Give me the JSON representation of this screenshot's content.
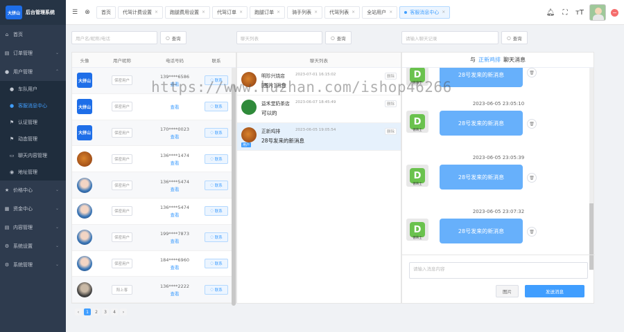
{
  "brand": {
    "logo": "大拼山",
    "name": "后台管理系统"
  },
  "sidebar": {
    "items": [
      {
        "label": "首页",
        "icon": "home-icon"
      },
      {
        "label": "订单管理",
        "icon": "order-icon"
      },
      {
        "label": "用户管理",
        "icon": "user-icon",
        "children": [
          {
            "label": "车队用户",
            "icon": "person-icon"
          },
          {
            "label": "客服消息中心",
            "icon": "person-icon",
            "active": true
          },
          {
            "label": "认证管理",
            "icon": "flag-icon"
          },
          {
            "label": "动态管理",
            "icon": "flag-icon"
          },
          {
            "label": "聊天内容管理",
            "icon": "chat-icon"
          },
          {
            "label": "地址管理",
            "icon": "location-icon"
          }
        ]
      },
      {
        "label": "价格中心",
        "icon": "star-icon"
      },
      {
        "label": "资金中心",
        "icon": "wallet-icon"
      },
      {
        "label": "内容管理",
        "icon": "doc-icon"
      },
      {
        "label": "系统设置",
        "icon": "gear-icon"
      },
      {
        "label": "系统管理",
        "icon": "gear-icon"
      }
    ]
  },
  "tabs": [
    {
      "label": "首页"
    },
    {
      "label": "代驾计费设置"
    },
    {
      "label": "跑腿费用设置"
    },
    {
      "label": "代驾订单"
    },
    {
      "label": "跑腿订单"
    },
    {
      "label": "骑手列表"
    },
    {
      "label": "代驾列表"
    },
    {
      "label": "全站用户"
    },
    {
      "label": "客服消息中心",
      "active": true
    }
  ],
  "search": {
    "users_placeholder": "用户名/昵称/电话",
    "chats_placeholder": "聊天列表",
    "history_placeholder": "请输入聊天记录",
    "button": "查询"
  },
  "users_table": {
    "headers": [
      "头像",
      "用户昵称",
      "电话号码",
      "联系"
    ],
    "rows": [
      {
        "avatar": "logo",
        "nickname": "保密用户",
        "phone": "139****6586",
        "view": "查看",
        "contact": "联系"
      },
      {
        "avatar": "logo",
        "nickname": "保密用户",
        "phone": "",
        "view": "查看",
        "contact": "联系"
      },
      {
        "avatar": "logo",
        "nickname": "保密用户",
        "phone": "170****0023",
        "view": "查看",
        "contact": "联系"
      },
      {
        "avatar": "food",
        "nickname": "保密用户",
        "phone": "136****1474",
        "view": "查看",
        "contact": "联系"
      },
      {
        "avatar": "girl",
        "nickname": "保密用户",
        "phone": "136****5474",
        "view": "查看",
        "contact": "联系"
      },
      {
        "avatar": "girl",
        "nickname": "保密用户",
        "phone": "136****5474",
        "view": "查看",
        "contact": "联系"
      },
      {
        "avatar": "girl",
        "nickname": "保密用户",
        "phone": "199****7873",
        "view": "查看",
        "contact": "联系"
      },
      {
        "avatar": "girl",
        "nickname": "保密用户",
        "phone": "184****6960",
        "view": "查看",
        "contact": "联系"
      },
      {
        "avatar": "dark",
        "nickname": "阳上客",
        "phone": "136****2222",
        "view": "查看",
        "contact": "联系"
      }
    ]
  },
  "pagination": {
    "prev": "‹",
    "pages": [
      "1",
      "2",
      "3",
      "4"
    ],
    "next": "›",
    "current": "1"
  },
  "chat_list": {
    "header": "聊天列表",
    "items": [
      {
        "name": "明珍兴烧店",
        "time": "2023-07-01 16:15:02",
        "message": "[图片]消息",
        "tag": "",
        "action": "删除"
      },
      {
        "name": "益禾堂奶茶店",
        "time": "2023-06-07 18:45:49",
        "message": "可以的",
        "tag": "",
        "action": "删除"
      },
      {
        "name": "正新鸡排",
        "time": "2023-06-05 19:05:54",
        "message": "28号发来的新消息",
        "tag": "用户",
        "action": "删除"
      }
    ]
  },
  "conversation": {
    "title_prefix": "与",
    "title_name": "正新鸡排",
    "title_suffix": "聊天消息",
    "messages": [
      {
        "time": "",
        "text": "28号发来的新消息",
        "avatar_label": "德育士"
      },
      {
        "time": "2023-06-05 23:05:10",
        "text": "28号发来的新消息",
        "avatar_label": "德育士"
      },
      {
        "time": "2023-06-05 23:05:39",
        "text": "28号发来的新消息",
        "avatar_label": "德育士"
      },
      {
        "time": "2023-06-05 23:07:32",
        "text": "28号发来的新消息",
        "avatar_label": "德育士"
      }
    ],
    "input_placeholder": "请输入消息内容",
    "image_button": "图片",
    "send_button": "发送消息"
  },
  "watermark": "https://www.huzhan.com/ishop46266",
  "colors": {
    "accent": "#409eff",
    "sidebar_bg": "#2e3b4e",
    "bubble": "#67b0fb"
  }
}
